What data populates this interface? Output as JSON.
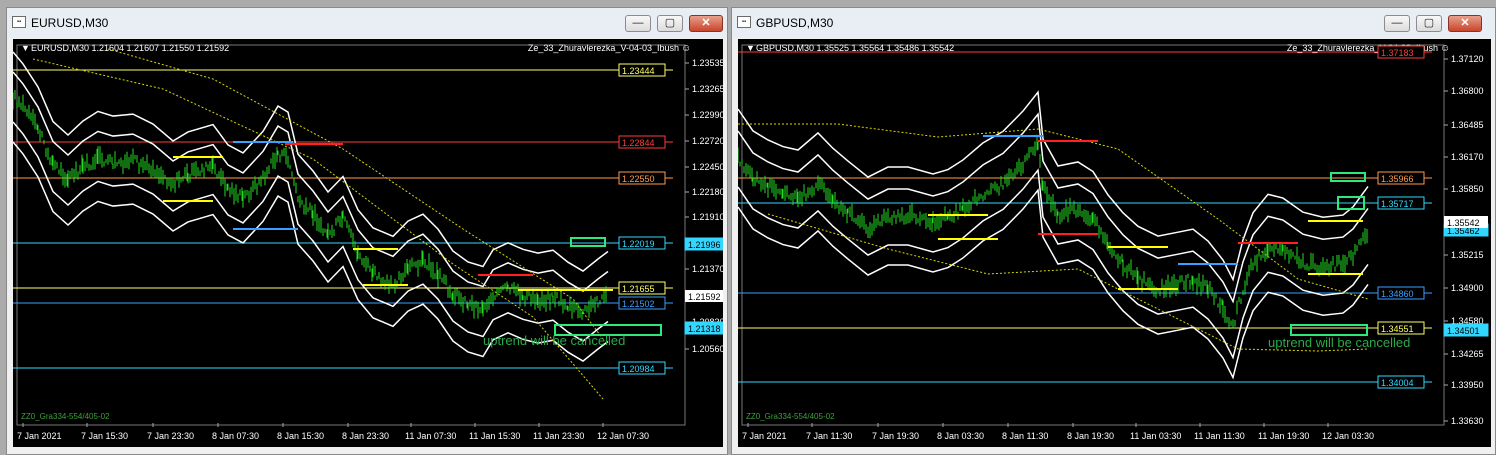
{
  "windows": [
    {
      "title": "EURUSD,M30",
      "header": "EURUSD,M30  1.21604 1.21607 1.21550 1.21592",
      "indicator": "Ze_33_Zhuravlerezka_V-04-03_Ibush",
      "footer": "ZZ0_Gra334-554/405-02",
      "annotation": "uptrend will be cancelled",
      "x_labels": [
        "7 Jan 2021",
        "7 Jan 15:30",
        "7 Jan 23:30",
        "8 Jan 07:30",
        "8 Jan 15:30",
        "8 Jan 23:30",
        "11 Jan 07:30",
        "11 Jan 15:30",
        "11 Jan 23:30",
        "12 Jan 07:30"
      ],
      "y_labels": [
        "1.23535",
        "1.23265",
        "1.22990",
        "1.22720",
        "1.22450",
        "1.22180",
        "1.21910",
        "1.21640",
        "1.21370",
        "1.21100",
        "1.20830",
        "1.20560"
      ],
      "ylim": [
        1.2046,
        1.2363
      ],
      "price": "1.21592",
      "levels": [
        {
          "label": "1.23444",
          "color": "#ffff66"
        },
        {
          "label": "1.22844",
          "color": "#ff3b3b"
        },
        {
          "label": "1.22550",
          "color": "#ff9a4a"
        },
        {
          "label": "1.22019",
          "color": "#32d7ff"
        },
        {
          "label": "1.21996",
          "color": "#32d7ff"
        },
        {
          "label": "1.21655",
          "color": "#ffff66"
        },
        {
          "label": "1.21502",
          "color": "#3aa0ff"
        },
        {
          "label": "1.21318",
          "color": "#32d7ff"
        },
        {
          "label": "1.20984",
          "color": "#32d7ff"
        }
      ]
    },
    {
      "title": "GBPUSD,M30",
      "header": "GBPUSD,M30  1.35525 1.35564 1.35486 1.35542",
      "indicator": "Ze_33_Zhuravlerezka_V-04-03_Ibush",
      "footer": "ZZ0_Gra334-554/405-02",
      "annotation": "uptrend will be cancelled",
      "x_labels": [
        "7 Jan 2021",
        "7 Jan 11:30",
        "7 Jan 19:30",
        "8 Jan 03:30",
        "8 Jan 11:30",
        "8 Jan 19:30",
        "11 Jan 03:30",
        "11 Jan 11:30",
        "11 Jan 19:30",
        "12 Jan 03:30"
      ],
      "y_labels": [
        "1.37120",
        "1.36800",
        "1.36485",
        "1.36170",
        "1.35850",
        "1.35530",
        "1.35215",
        "1.34900",
        "1.34580",
        "1.34265",
        "1.33950",
        "1.33630"
      ],
      "ylim": [
        1.3353,
        1.373
      ],
      "price": "1.35542",
      "levels": [
        {
          "label": "1.37183",
          "color": "#ff3b3b"
        },
        {
          "label": "1.35966",
          "color": "#ff9a4a"
        },
        {
          "label": "1.35717",
          "color": "#32d7ff"
        },
        {
          "label": "1.35462",
          "color": "#32d7ff"
        },
        {
          "label": "1.34860",
          "color": "#3aa0ff"
        },
        {
          "label": "1.34551",
          "color": "#ffff66"
        },
        {
          "label": "1.34501",
          "color": "#32d7ff"
        },
        {
          "label": "1.34004",
          "color": "#32d7ff"
        }
      ]
    }
  ]
}
